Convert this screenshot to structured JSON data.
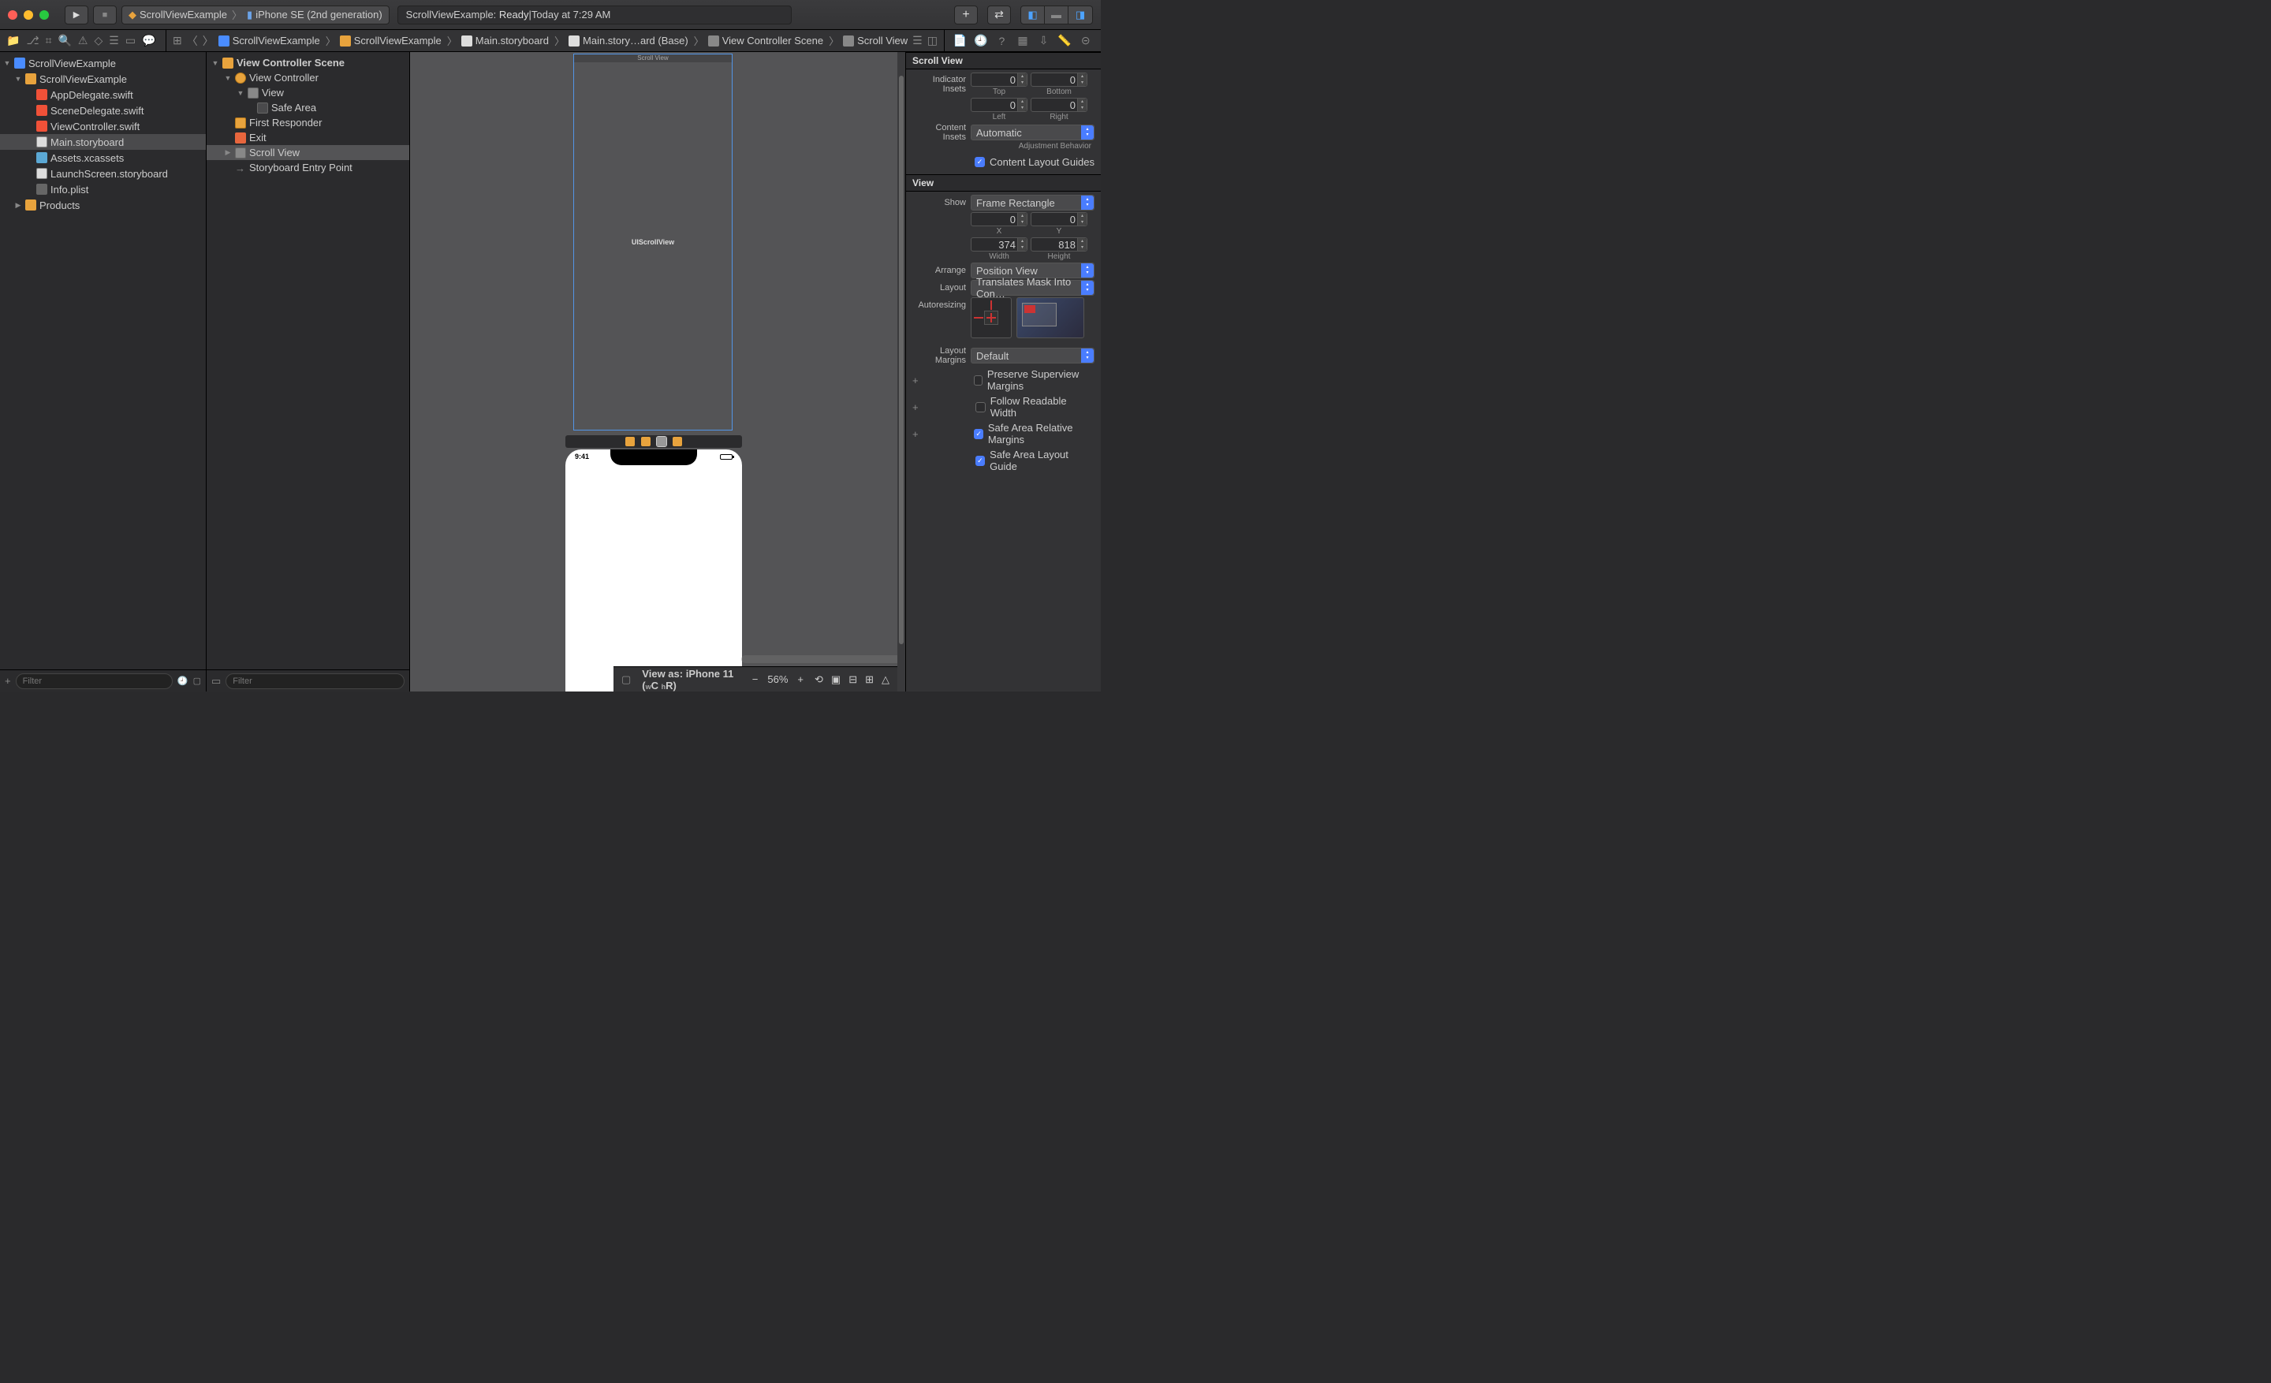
{
  "titlebar": {
    "scheme_target": "ScrollViewExample",
    "scheme_device": "iPhone SE (2nd generation)",
    "status_project": "ScrollViewExample:",
    "status_state": "Ready",
    "status_sep": " | ",
    "status_time": "Today at 7:29 AM"
  },
  "breadcrumb": [
    {
      "label": "ScrollViewExample",
      "icon": "app"
    },
    {
      "label": "ScrollViewExample",
      "icon": "folder"
    },
    {
      "label": "Main.storyboard",
      "icon": "sb"
    },
    {
      "label": "Main.story…ard (Base)",
      "icon": "sb"
    },
    {
      "label": "View Controller Scene",
      "icon": "view"
    },
    {
      "label": "Scroll View",
      "icon": "view"
    }
  ],
  "navigator": {
    "filter_placeholder": "Filter",
    "tree": {
      "project": "ScrollViewExample",
      "group": "ScrollViewExample",
      "files": [
        "AppDelegate.swift",
        "SceneDelegate.swift",
        "ViewController.swift",
        "Main.storyboard",
        "Assets.xcassets",
        "LaunchScreen.storyboard",
        "Info.plist"
      ],
      "products": "Products"
    }
  },
  "outline": {
    "filter_placeholder": "Filter",
    "scene": "View Controller Scene",
    "vc": "View Controller",
    "view": "View",
    "safearea": "Safe Area",
    "first_responder": "First Responder",
    "exit": "Exit",
    "scroll_view": "Scroll View",
    "entry": "Storyboard Entry Point"
  },
  "canvas": {
    "scrollview_title": "Scroll View",
    "scrollview_class": "UIScrollView",
    "phone_time": "9:41"
  },
  "bottombar": {
    "viewas_prefix": "View as: ",
    "viewas_device": "iPhone 11 (",
    "viewas_w": "w",
    "viewas_c": "C ",
    "viewas_h": "h",
    "viewas_r": "R)",
    "zoom": "56%"
  },
  "inspector": {
    "scrollview_title": "Scroll View",
    "indicator_insets_label": "Indicator Insets",
    "insets": {
      "top": "0",
      "bottom": "0",
      "left": "0",
      "right": "0"
    },
    "inset_labels": {
      "top": "Top",
      "bottom": "Bottom",
      "left": "Left",
      "right": "Right"
    },
    "content_insets_label": "Content Insets",
    "content_insets_value": "Automatic",
    "adjustment_behavior_label": "Adjustment Behavior",
    "content_layout_guides": "Content Layout Guides",
    "view_title": "View",
    "show_label": "Show",
    "show_value": "Frame Rectangle",
    "frame": {
      "x": "0",
      "y": "0",
      "width": "374",
      "height": "818"
    },
    "frame_labels": {
      "x": "X",
      "y": "Y",
      "width": "Width",
      "height": "Height"
    },
    "arrange_label": "Arrange",
    "arrange_value": "Position View",
    "layout_label": "Layout",
    "layout_value": "Translates Mask Into Con…",
    "autoresizing_label": "Autoresizing",
    "layout_margins_label": "Layout Margins",
    "layout_margins_value": "Default",
    "preserve_superview": "Preserve Superview Margins",
    "follow_readable": "Follow Readable Width",
    "safe_area_relative": "Safe Area Relative Margins",
    "safe_area_layout_guide": "Safe Area Layout Guide"
  }
}
